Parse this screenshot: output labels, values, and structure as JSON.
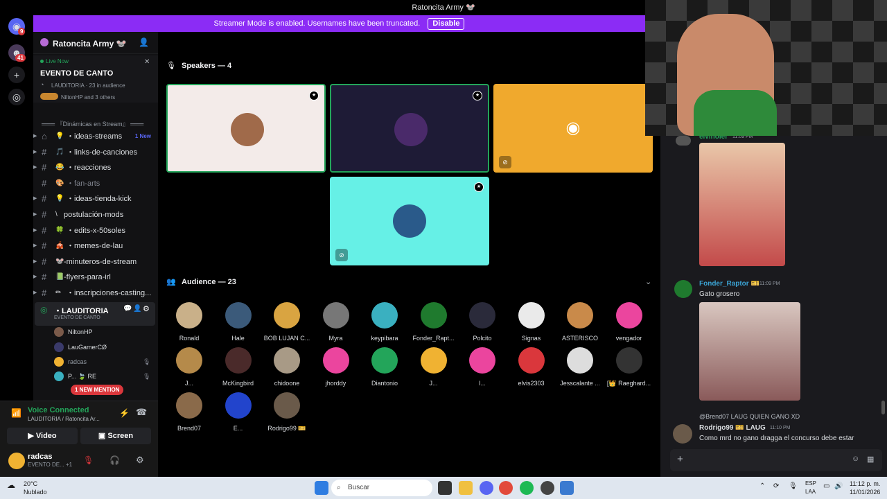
{
  "window": {
    "title": "Ratoncita Army 🐭"
  },
  "rail": {
    "badge1": "9",
    "badge2": "41"
  },
  "banner": {
    "text": "Streamer Mode is enabled. Usernames have been truncated.",
    "disable": "Disable"
  },
  "server": {
    "name": "Ratoncita Army 🐭"
  },
  "live": {
    "status": "Live Now",
    "title": "EVENTO DE CANTO",
    "sub": "LAUDITORIA · 23 in audience",
    "sub2": "NiltonHP and 3 others"
  },
  "sidebar": {
    "category": "═══ 『Dinámicas en Stream』 ═══",
    "channels": [
      {
        "emoji": "💡",
        "label": "・ideas-streams",
        "extra": "1 New"
      },
      {
        "emoji": "🎵",
        "label": "・links-de-canciones",
        "extra": ""
      },
      {
        "emoji": "😂",
        "label": "・reacciones",
        "extra": ""
      },
      {
        "emoji": "🎨",
        "label": "・fan-arts",
        "extra": ""
      },
      {
        "emoji": "💡",
        "label": "・ideas-tienda-kick",
        "extra": ""
      },
      {
        "emoji": "\\",
        "label": "postulación-mods",
        "extra": ""
      },
      {
        "emoji": "🍀",
        "label": "・edits-x-50soles",
        "extra": ""
      },
      {
        "emoji": "🎪",
        "label": "・memes-de-lau",
        "extra": ""
      },
      {
        "emoji": "🐭",
        "label": "-minuteros-de-stream",
        "extra": ""
      },
      {
        "emoji": "📗",
        "label": "-flyers-para-irl",
        "extra": ""
      },
      {
        "emoji": "✏",
        "label": "・inscripciones-casting...",
        "extra": ""
      }
    ],
    "voice_channel": {
      "name": "・LAUDITORIA",
      "sub": "EVENTO DE CANTO"
    },
    "users": [
      "NiltonHP",
      "LauGamerCØ",
      "radcas",
      "P...  🍃 RE"
    ],
    "mention": "1 NEW MENTION"
  },
  "voice_panel": {
    "title": "Voice Connected",
    "sub": "LAUDITORIA / Ratoncita Ar...",
    "video": "Video",
    "screen": "Screen",
    "user": "radcas",
    "user_sub": "EVENTO DE...  +1"
  },
  "stage": {
    "speakers_title": "Speakers — 4",
    "audience_title": "Audience — 23",
    "audience": [
      "Ronald",
      "Hale",
      "BOB LUJAN C...",
      "Myra",
      "keypibara",
      "Fonder_Rapt...",
      "Polcito",
      "Signas",
      "ASTERISCO",
      "vengador",
      "J...",
      "McKingbird",
      "chidoone",
      "jhorddy",
      "Diantonio",
      "J...",
      "l...",
      "elvis2303",
      "Jesscalante ...",
      "[👑 Raeghard...",
      "Brend07",
      "E...",
      "Rodrigo99 🎫"
    ],
    "audience_colors": [
      "#c9b089",
      "#3b5a7a",
      "#d9a441",
      "#777",
      "#3ab0c0",
      "#1f7a2e",
      "#2a2a3a",
      "#eaeaea",
      "#c98a4a",
      "#eb459e",
      "#b58a4a",
      "#4a2a2a",
      "#a89a86",
      "#eb459e",
      "#23a55a",
      "#f0b232",
      "#eb459e",
      "#da373c",
      "#ddd",
      "#333",
      "#8a6a4a",
      "#2244cc",
      "#6a5a4a"
    ],
    "speaker_colors": [
      "#f3ebe9",
      "#1e1b36",
      "#f0a92d",
      "#66f0e6"
    ]
  },
  "chat": {
    "top_name": "elvinoler",
    "top_time": "11:09 PM",
    "msg1_name": "Fonder_Raptor 🎫",
    "msg1_time": "11:09 PM",
    "msg1_text": "Gato grosero",
    "reply_text": "@Brend07  LAUG  QUIEN GANO XD",
    "msg2_name": "Rodrigo99 🎫  LAUG",
    "msg2_time": "11:10 PM",
    "msg2_text": "Como mrd no gano dragga el concurso debe estar"
  },
  "taskbar": {
    "temp": "20°C",
    "weather": "Nublado",
    "search": "Buscar",
    "lang": "ESP",
    "lang2": "LAA",
    "time": "11:12 p. m.",
    "date": "11/01/2026"
  },
  "colors": {
    "accent": "#8b2cf5",
    "green": "#23a55a",
    "red": "#da373c",
    "blurple": "#5865f2"
  }
}
